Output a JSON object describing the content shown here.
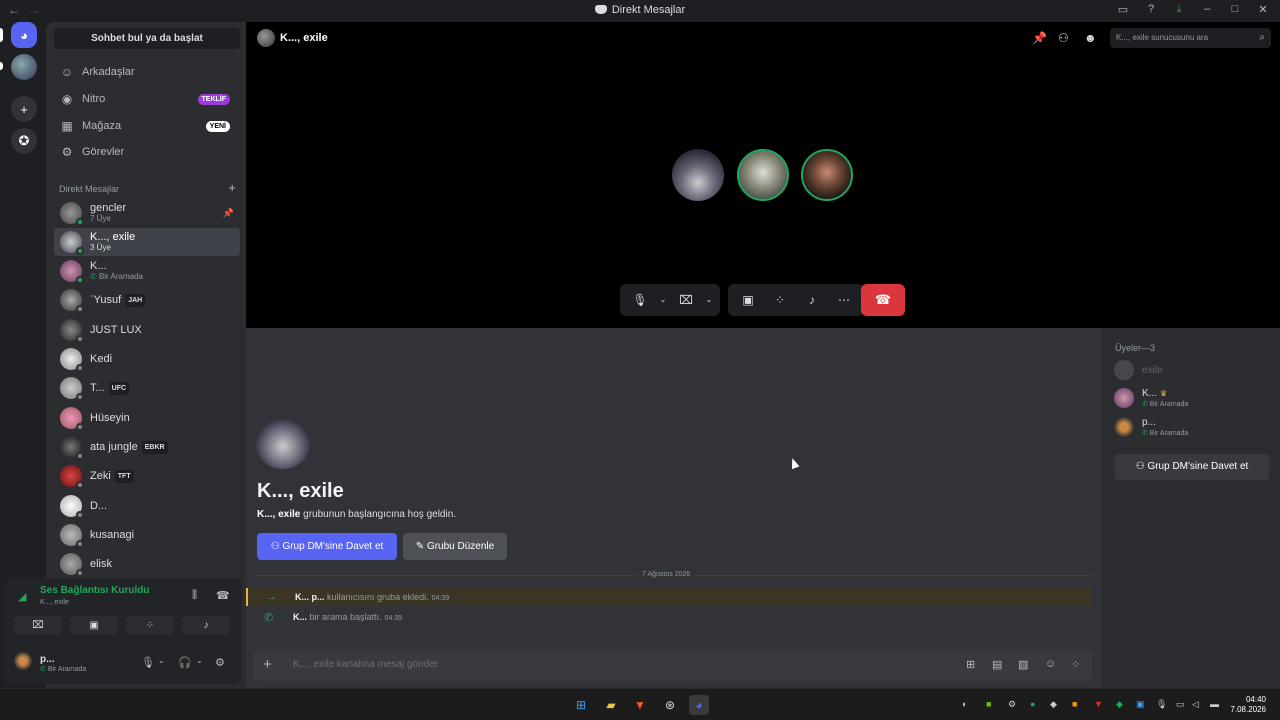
{
  "window": {
    "title": "Direkt Mesajlar"
  },
  "sidebar": {
    "search_label": "Sohbet bul ya da başlat",
    "nav": [
      {
        "label": "Arkadaşlar",
        "icon": "friends-icon"
      },
      {
        "label": "Nitro",
        "icon": "nitro-icon",
        "badge": "TEKLİF"
      },
      {
        "label": "Mağaza",
        "icon": "shop-icon",
        "badge": "YENİ"
      },
      {
        "label": "Görevler",
        "icon": "quests-icon"
      }
    ],
    "dm_header": "Direkt Mesajlar",
    "dms": [
      {
        "name": "gencler",
        "sub": "7 Üye"
      },
      {
        "name": "K..., exile",
        "sub": "3 Üye"
      },
      {
        "name": "K...",
        "sub": "Bir Aramada"
      },
      {
        "name": "ʿYusuf",
        "tag": "JAH"
      },
      {
        "name": "JUST LUX"
      },
      {
        "name": "Kedi"
      },
      {
        "name": "T...",
        "tag": "UFC"
      },
      {
        "name": "Hüseyin"
      },
      {
        "name": "ata jungle",
        "tag": "EBKR"
      },
      {
        "name": "Zeki",
        "tag": "TFT"
      },
      {
        "name": "D..."
      },
      {
        "name": "kusanagi"
      },
      {
        "name": "elisk"
      }
    ]
  },
  "voice": {
    "status": "Ses Bağlantısı Kuruldu",
    "channel": "K..., exile",
    "user_name": "p...",
    "user_status": "Bir Aramada"
  },
  "channel": {
    "title": "K..., exile",
    "search_placeholder": "K..., exile sunucusunu ara"
  },
  "welcome": {
    "title": "K..., exile",
    "sub_bold": "K..., exile",
    "sub_rest": " grubunun başlangıcına hoş geldin.",
    "invite_label": "Grup DM'sine Davet et",
    "edit_label": "Grubu Düzenle"
  },
  "messages": {
    "date": "7 Ağustos 2026",
    "items": [
      {
        "actor": "K...",
        "target": "p...",
        "text": " kullanıcısını gruba ekledi.",
        "time": "04:39"
      },
      {
        "actor": "K...",
        "text": " bir arama başlattı.",
        "time": "04:39"
      }
    ]
  },
  "composer": {
    "placeholder": "K..., exile kanalına mesaj gönder"
  },
  "members": {
    "header": "Üyeler—3",
    "list": [
      {
        "name": "exile"
      },
      {
        "name": "K...",
        "status": "Bir Aramada"
      },
      {
        "name": "p...",
        "status": "Bir Aramada"
      }
    ],
    "invite_label": "Grup DM'sine Davet et"
  },
  "taskbar": {
    "time": "04:40",
    "date": "7.08.2026"
  },
  "colors": {
    "accent": "#5865f2",
    "online": "#23a55a",
    "danger": "#da373c"
  }
}
